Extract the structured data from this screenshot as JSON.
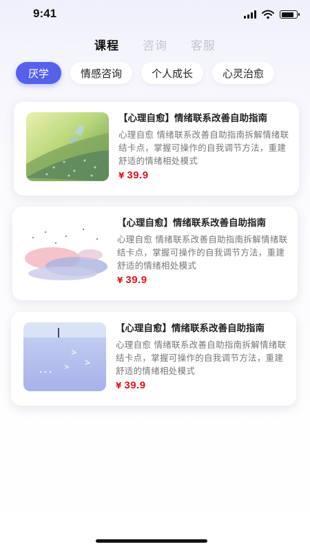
{
  "status_bar": {
    "time": "9:41",
    "battery_level": 0.85
  },
  "top_tabs": [
    {
      "label": "课程",
      "active": true
    },
    {
      "label": "咨询",
      "active": false
    },
    {
      "label": "客服",
      "active": false
    }
  ],
  "chips": [
    {
      "label": "厌学",
      "active": true
    },
    {
      "label": "情感咨询",
      "active": false
    },
    {
      "label": "个人成长",
      "active": false
    },
    {
      "label": "心灵治愈",
      "active": false
    }
  ],
  "courses": [
    {
      "title": "【心理自愈】情绪联系改善自助指南",
      "desc": "心理自愈 情绪联系改善自助指南拆解情绪联结卡点，掌握可操作的自我调节方法，重建舒适的情绪相处模式",
      "currency": "¥",
      "price": "39.9",
      "image_icon": "meadow-illustration-icon"
    },
    {
      "title": "【心理自愈】情绪联系改善自助指南",
      "desc": "心理自愈 情绪联系改善自助指南拆解情绪联结卡点，掌握可操作的自我调节方法，重建舒适的情绪相处模式",
      "currency": "¥",
      "price": "39.9",
      "image_icon": "blossom-illustration-icon"
    },
    {
      "title": "【心理自愈】情绪联系改善自助指南",
      "desc": "心理自愈 情绪联系改善自助指南拆解情绪联结卡点，掌握可操作的自我调节方法，重建舒适的情绪相处模式",
      "currency": "¥",
      "price": "39.9",
      "image_icon": "lake-illustration-icon"
    }
  ],
  "colors": {
    "accent": "#5561ea",
    "price": "#e4131e",
    "inactive_tab": "#c4c4cc"
  }
}
